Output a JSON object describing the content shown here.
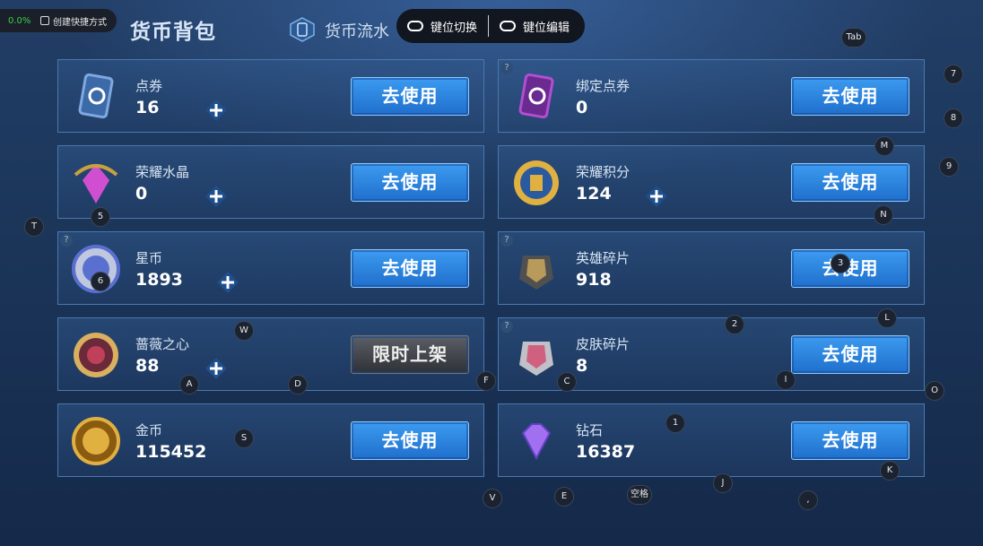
{
  "overlay": {
    "fps_percent": "0.0%",
    "shortcut_label": "创建快捷方式"
  },
  "header": {
    "title": "货币背包",
    "flow_tab": "货币流水",
    "key_switch": "键位切换",
    "key_edit": "键位编辑"
  },
  "cards": [
    {
      "name": "点券",
      "value": "16",
      "button": "去使用",
      "plus": true,
      "help": false
    },
    {
      "name": "绑定点券",
      "value": "0",
      "button": "去使用",
      "plus": false,
      "help": true
    },
    {
      "name": "荣耀水晶",
      "value": "0",
      "button": "去使用",
      "plus": true,
      "help": false
    },
    {
      "name": "荣耀积分",
      "value": "124",
      "button": "去使用",
      "plus": true,
      "help": false
    },
    {
      "name": "星币",
      "value": "1893",
      "button": "去使用",
      "plus": true,
      "help": true
    },
    {
      "name": "英雄碎片",
      "value": "918",
      "button": "去使用",
      "plus": false,
      "help": true
    },
    {
      "name": "蔷薇之心",
      "value": "88",
      "button": "限时上架",
      "plus": true,
      "help": false
    },
    {
      "name": "皮肤碎片",
      "value": "8",
      "button": "去使用",
      "plus": false,
      "help": true
    },
    {
      "name": "金币",
      "value": "115452",
      "button": "去使用",
      "plus": false,
      "help": false
    },
    {
      "name": "钻石",
      "value": "16387",
      "button": "去使用",
      "plus": false,
      "help": false
    }
  ],
  "key_hints": [
    "Tab",
    "7",
    "8",
    "M",
    "9",
    "T",
    "5",
    "N",
    "6",
    "3",
    "W",
    "2",
    "L",
    "A",
    "D",
    "F",
    "C",
    "I",
    "O",
    "S",
    "1",
    "K",
    "V",
    "E",
    "空格",
    "J",
    ","
  ],
  "colors": {
    "button": "#2a85e0",
    "card_border": "#4a78ad",
    "background": "#1b3559"
  }
}
